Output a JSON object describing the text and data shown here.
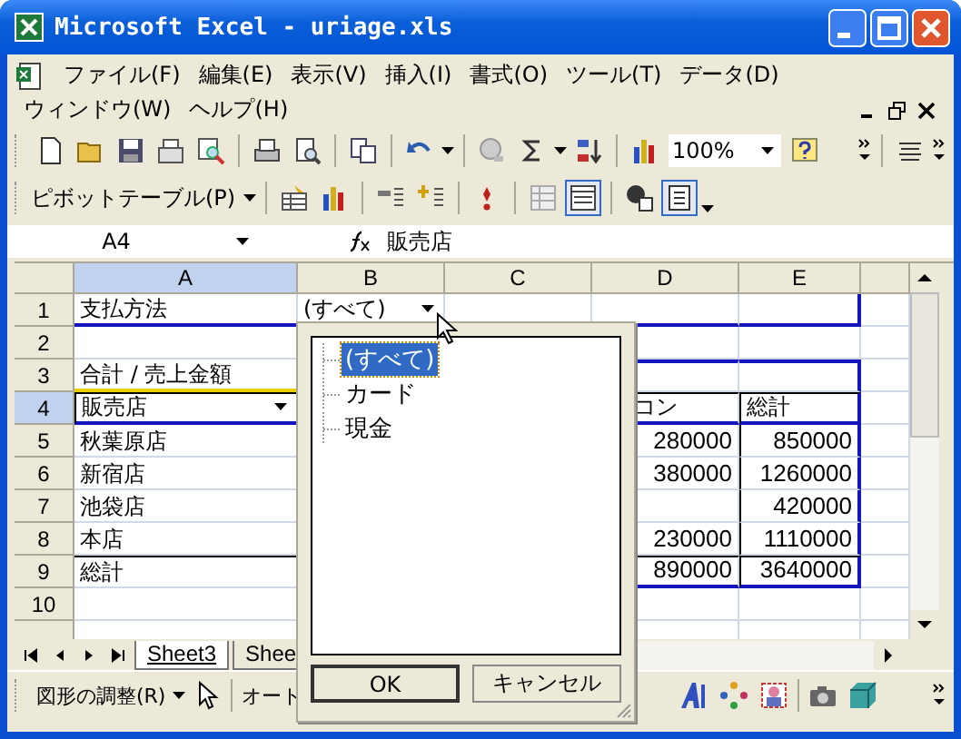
{
  "window": {
    "title": "Microsoft Excel - uriage.xls"
  },
  "menu": [
    {
      "label": "ファイル(F)"
    },
    {
      "label": "編集(E)"
    },
    {
      "label": "表示(V)"
    },
    {
      "label": "挿入(I)"
    },
    {
      "label": "書式(O)"
    },
    {
      "label": "ツール(T)"
    },
    {
      "label": "データ(D)"
    },
    {
      "label": "ウィンドウ(W)"
    },
    {
      "label": "ヘルプ(H)"
    }
  ],
  "toolbar": {
    "zoom": "100%"
  },
  "pivot_toolbar": {
    "label": "ピボットテーブル(P)"
  },
  "formula_bar": {
    "name_box": "A4",
    "formula": "販売店"
  },
  "sheet": {
    "columns": [
      {
        "label": "A",
        "selected": true
      },
      {
        "label": "B",
        "selected": false
      },
      {
        "label": "C",
        "selected": false
      },
      {
        "label": "D",
        "selected": false
      },
      {
        "label": "E",
        "selected": false
      }
    ],
    "rows": [
      {
        "number": "1",
        "selected": false,
        "kind": "filter",
        "a": "支払方法",
        "b": "(すべて)"
      },
      {
        "number": "2",
        "selected": false,
        "kind": "blank"
      },
      {
        "number": "3",
        "selected": false,
        "kind": "title",
        "a": "合計 / 売上金額"
      },
      {
        "number": "4",
        "selected": true,
        "kind": "header",
        "a": "販売店",
        "d": "コン",
        "e": "総計"
      },
      {
        "number": "5",
        "selected": false,
        "kind": "data",
        "a": "秋葉原店",
        "d": "280000",
        "e": "850000"
      },
      {
        "number": "6",
        "selected": false,
        "kind": "data",
        "a": "新宿店",
        "d": "380000",
        "e": "1260000"
      },
      {
        "number": "7",
        "selected": false,
        "kind": "data",
        "a": "池袋店",
        "e": "420000"
      },
      {
        "number": "8",
        "selected": false,
        "kind": "data",
        "a": "本店",
        "d": "230000",
        "e": "1110000"
      },
      {
        "number": "9",
        "selected": false,
        "kind": "total",
        "a": "総計",
        "d": "890000",
        "e": "3640000"
      },
      {
        "number": "10",
        "selected": false,
        "kind": "blank"
      }
    ]
  },
  "sheet_tabs": [
    {
      "label": "Sheet3",
      "selected": true
    },
    {
      "label": "Shee",
      "selected": false
    }
  ],
  "drawing_toolbar": {
    "label": "図形の調整(R)",
    "autoshapes": "オート"
  },
  "filter_popup": {
    "items": [
      {
        "label": "(すべて)",
        "selected": true
      },
      {
        "label": "カード",
        "selected": false
      },
      {
        "label": "現金",
        "selected": false
      }
    ],
    "buttons": [
      "OK",
      "キャンセル"
    ]
  }
}
